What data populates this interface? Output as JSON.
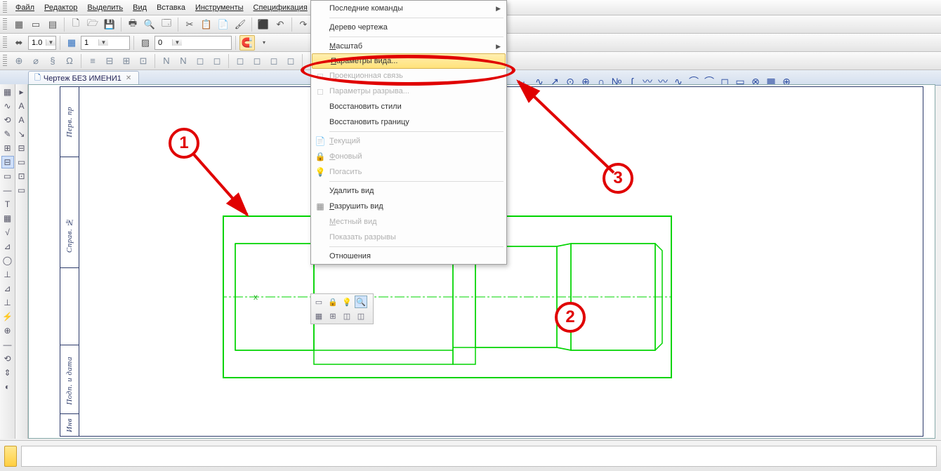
{
  "menubar": {
    "items": [
      {
        "label": "Файл",
        "u": 0
      },
      {
        "label": "Редактор",
        "u": 0
      },
      {
        "label": "Выделить",
        "u": 0
      },
      {
        "label": "Вид",
        "u": 0
      },
      {
        "label": "Вставка",
        "u": -1
      },
      {
        "label": "Инструменты",
        "u": 0
      },
      {
        "label": "Спецификация",
        "u": 0
      }
    ]
  },
  "toolbar_top": {
    "icons": [
      "▦",
      "▭",
      "▤",
      "🗋",
      "🗁",
      "💾",
      "🖶",
      "🔍",
      "🗔",
      "✂",
      "📋",
      "📄",
      "🖌",
      "⬛",
      "↶",
      "↷",
      "▦",
      "▤",
      "🟦",
      "f(x)",
      "▶"
    ]
  },
  "toolbar_row2": {
    "combo1": "1.0",
    "combo2": "1",
    "combo3": "0",
    "icons_left": [
      "⬌",
      "▭",
      "▭"
    ],
    "magnet": "🧲"
  },
  "toolbar_row3": {
    "icons": [
      "⊕",
      "⌀",
      "§",
      "Ω",
      "≡",
      "⊟",
      "⊞",
      "⊡",
      "N",
      "N",
      "◻",
      "◻",
      "◻",
      "◻",
      "◻",
      "◻",
      "◻",
      "◻",
      "◻",
      "◻",
      "📷",
      "📷",
      "🖼"
    ]
  },
  "curvebar": {
    "icons": [
      "·",
      "∿",
      "↗",
      "⊙",
      "⊕",
      "∩",
      "№",
      "ʃ",
      "〰",
      "〰",
      "∿",
      "⌒",
      "⌒",
      "◻",
      "▭",
      "⊗",
      "▦",
      "⊕"
    ]
  },
  "tab": {
    "title": "Чертеж БЕЗ ИМЕНИ1"
  },
  "left_tools": {
    "col1": [
      "▦",
      "∿",
      "⟲",
      "✎",
      "⊞",
      "⊟",
      "▭",
      "—",
      "T",
      "▦",
      "√",
      "⊿",
      "◯",
      "⊥",
      "⊿",
      "⊥",
      "⚡",
      "⊕",
      "—",
      "⟲",
      "⇕",
      "◐"
    ],
    "col2": [
      "▸",
      "A",
      "A",
      "↘",
      "⊟",
      "▭",
      "⊡",
      "▭"
    ]
  },
  "frame": {
    "labels": [
      "Перв. пр",
      "Справ. №",
      "Подп. и дата",
      "Инв"
    ]
  },
  "context_menu": {
    "items": [
      {
        "label": "Последние команды",
        "icon": "",
        "disabled": false,
        "submenu": true,
        "u": -1
      },
      {
        "sep": true
      },
      {
        "label": "Дерево чертежа",
        "icon": "",
        "disabled": false,
        "u": 0
      },
      {
        "sep": true
      },
      {
        "label": "Масштаб",
        "icon": "",
        "disabled": false,
        "submenu": true,
        "u": 0
      },
      {
        "label": "Параметры вида...",
        "icon": "",
        "disabled": false,
        "highlight": true,
        "u": 0
      },
      {
        "label": "Проекционная связь",
        "icon": "◻",
        "disabled": true,
        "u": -1
      },
      {
        "label": "Параметры разрыва...",
        "icon": "◻",
        "disabled": true,
        "u": -1
      },
      {
        "label": "Восстановить стили",
        "icon": "",
        "disabled": false,
        "u": -1
      },
      {
        "label": "Восстановить границу",
        "icon": "",
        "disabled": false,
        "u": -1
      },
      {
        "sep": true
      },
      {
        "label": "Текущий",
        "icon": "📄",
        "disabled": true,
        "u": 0
      },
      {
        "label": "Фоновый",
        "icon": "🔒",
        "disabled": true,
        "u": 0
      },
      {
        "label": "Погасить",
        "icon": "💡",
        "disabled": true,
        "u": -1
      },
      {
        "sep": true
      },
      {
        "label": "Удалить вид",
        "icon": "",
        "disabled": false,
        "u": -1
      },
      {
        "label": "Разрушить вид",
        "icon": "▦",
        "disabled": false,
        "u": 0
      },
      {
        "label": "Местный вид",
        "icon": "",
        "disabled": true,
        "u": 0
      },
      {
        "label": "Показать разрывы",
        "icon": "",
        "disabled": true,
        "u": -1
      },
      {
        "sep": true
      },
      {
        "label": "Отношения",
        "icon": "",
        "disabled": false,
        "u": -1
      }
    ]
  },
  "mini_toolbar": {
    "icons": [
      "▭",
      "🔒",
      "💡",
      "🔍",
      "▦",
      "⊞",
      "◫",
      "◫"
    ]
  },
  "annotations": {
    "n1": "1",
    "n2": "2",
    "n3": "3"
  },
  "origin_label": "X"
}
